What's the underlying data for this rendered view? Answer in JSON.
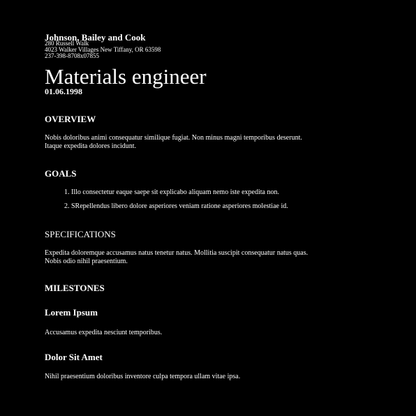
{
  "company": {
    "name": "Johnson, Bailey and Cook",
    "address_line1": "280 Russell Walk",
    "address_line2": "4023 Walker Villages New Tiffany, OR 63598",
    "phone": "237-398-8708x07855"
  },
  "document": {
    "title": "Materials engineer",
    "date": "01.06.1998"
  },
  "overview": {
    "heading": "OVERVIEW",
    "text": "Nobis doloribus animi consequatur similique fugiat. Non minus magni temporibus deserunt. Itaque expedita dolores incidunt."
  },
  "goals": {
    "heading": "GOALS",
    "items": [
      "1. Illo consectetur eaque saepe sit explicabo aliquam nemo iste expedita non.",
      "2. SRepellendus libero dolore asperiores veniam ratione asperiores molestiae id."
    ]
  },
  "specifications": {
    "heading": "SPECIFICATIONS",
    "text": "Expedita doloremque accusamus natus tenetur natus. Mollitia suscipit consequatur natus quas. Nobis odio nihil praesentium."
  },
  "milestones": {
    "heading": "MILESTONES",
    "items": [
      {
        "title": "Lorem Ipsum",
        "text": "Accusamus expedita nesciunt temporibus."
      },
      {
        "title": "Dolor Sit Amet",
        "text": "Nihil praesentium doloribus inventore culpa tempora ullam vitae ipsa."
      }
    ]
  }
}
